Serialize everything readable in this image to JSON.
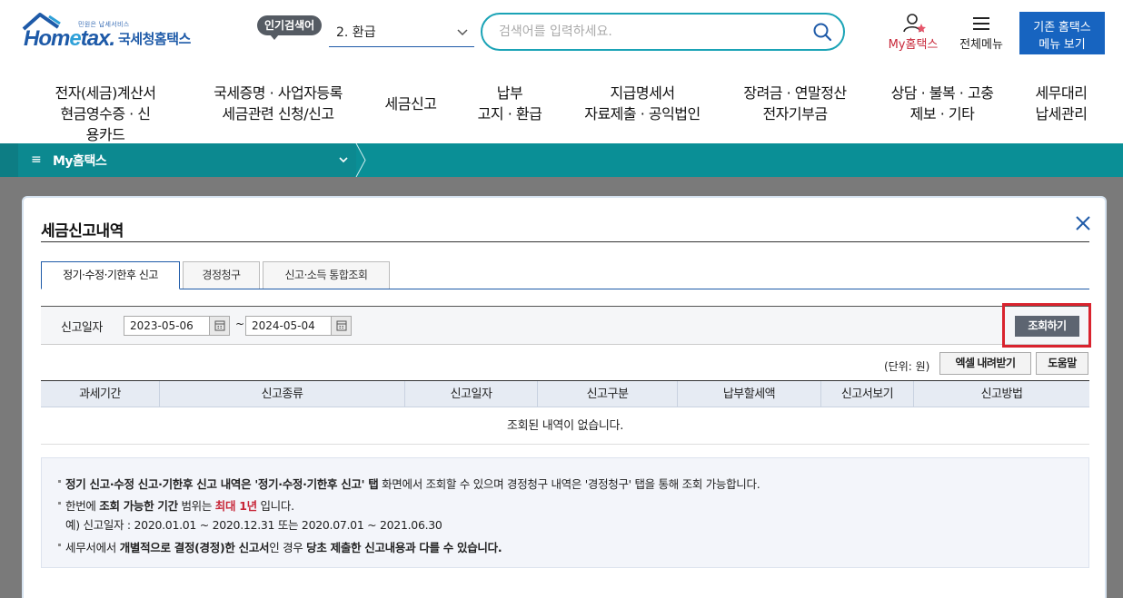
{
  "header": {
    "logo_small_tag": "민원은 납세서비스",
    "logo_word_home": "Hom",
    "logo_word_e": "e",
    "logo_word_tax": "tax.",
    "logo_ko": "국세청홈택스",
    "popular_label": "인기검색어",
    "popular_value": "2.  환급",
    "search_placeholder": "검색어를 입력하세요.",
    "my_hometax": "My홈택스",
    "all_menu": "전체메뉴",
    "old_menu_line1": "기존 홈택스",
    "old_menu_line2": "메뉴 보기"
  },
  "gnb": [
    {
      "line1": "전자(세금)계산서",
      "line2": "현금영수증 · 신용카드"
    },
    {
      "line1": "국세증명 · 사업자등록",
      "line2": "세금관련 신청/신고"
    },
    {
      "line1": "세금신고",
      "line2": ""
    },
    {
      "line1": "납부",
      "line2": "고지 · 환급"
    },
    {
      "line1": "지급명세서",
      "line2": "자료제출 · 공익법인"
    },
    {
      "line1": "장려금 · 연말정산",
      "line2": "전자기부금"
    },
    {
      "line1": "상담 · 불복 · 고충",
      "line2": "제보 · 기타"
    },
    {
      "line1": "세무대리",
      "line2": "납세관리"
    }
  ],
  "breadcrumb": {
    "label": "My홈택스"
  },
  "modal": {
    "title": "세금신고내역",
    "tabs": [
      "정기·수정·기한후 신고",
      "경정청구",
      "신고·소득 통합조회"
    ],
    "filter_label": "신고일자",
    "date_from": "2023-05-06",
    "date_to": "2024-05-04",
    "tilde": "~",
    "search_button": "조회하기",
    "unit": "(단위: 원)",
    "excel_button": "엑셀 내려받기",
    "help_button": "도움말",
    "columns": [
      "과세기간",
      "신고종류",
      "신고일자",
      "신고구분",
      "납부할세액",
      "신고서보기",
      "신고방법"
    ],
    "empty_message": "조회된 내역이 없습니다.",
    "notice": {
      "l1_b": "정기 신고·수정 신고·기한후 신고 내역은 '정기·수정·기한후 신고' 탭",
      "l1_r": " 화면에서 조회할 수 있으며 경정청구 내역은  '경정청구' 탭을 통해 조회 가능합니다.",
      "l2_a": "한번에 ",
      "l2_b": "조회 가능한 기간",
      "l2_c": " 범위는 ",
      "l2_red": "최대 1년",
      "l2_d": " 입니다.",
      "l3": "예) 신고일자 : 2020.01.01 ~ 2020.12.31 또는 2020.07.01 ~ 2021.06.30",
      "l4_a": "세무서에서 ",
      "l4_b": "개별적으로 결정(경정)한 신고서",
      "l4_c": "인 경우 ",
      "l4_d": "당초 제출한 신고내용과 다를 수 있습니다."
    }
  },
  "colors": {
    "brand_blue": "#1e5aa8",
    "teal_bar": "#0a8f96",
    "highlight_red": "#d9232e"
  }
}
